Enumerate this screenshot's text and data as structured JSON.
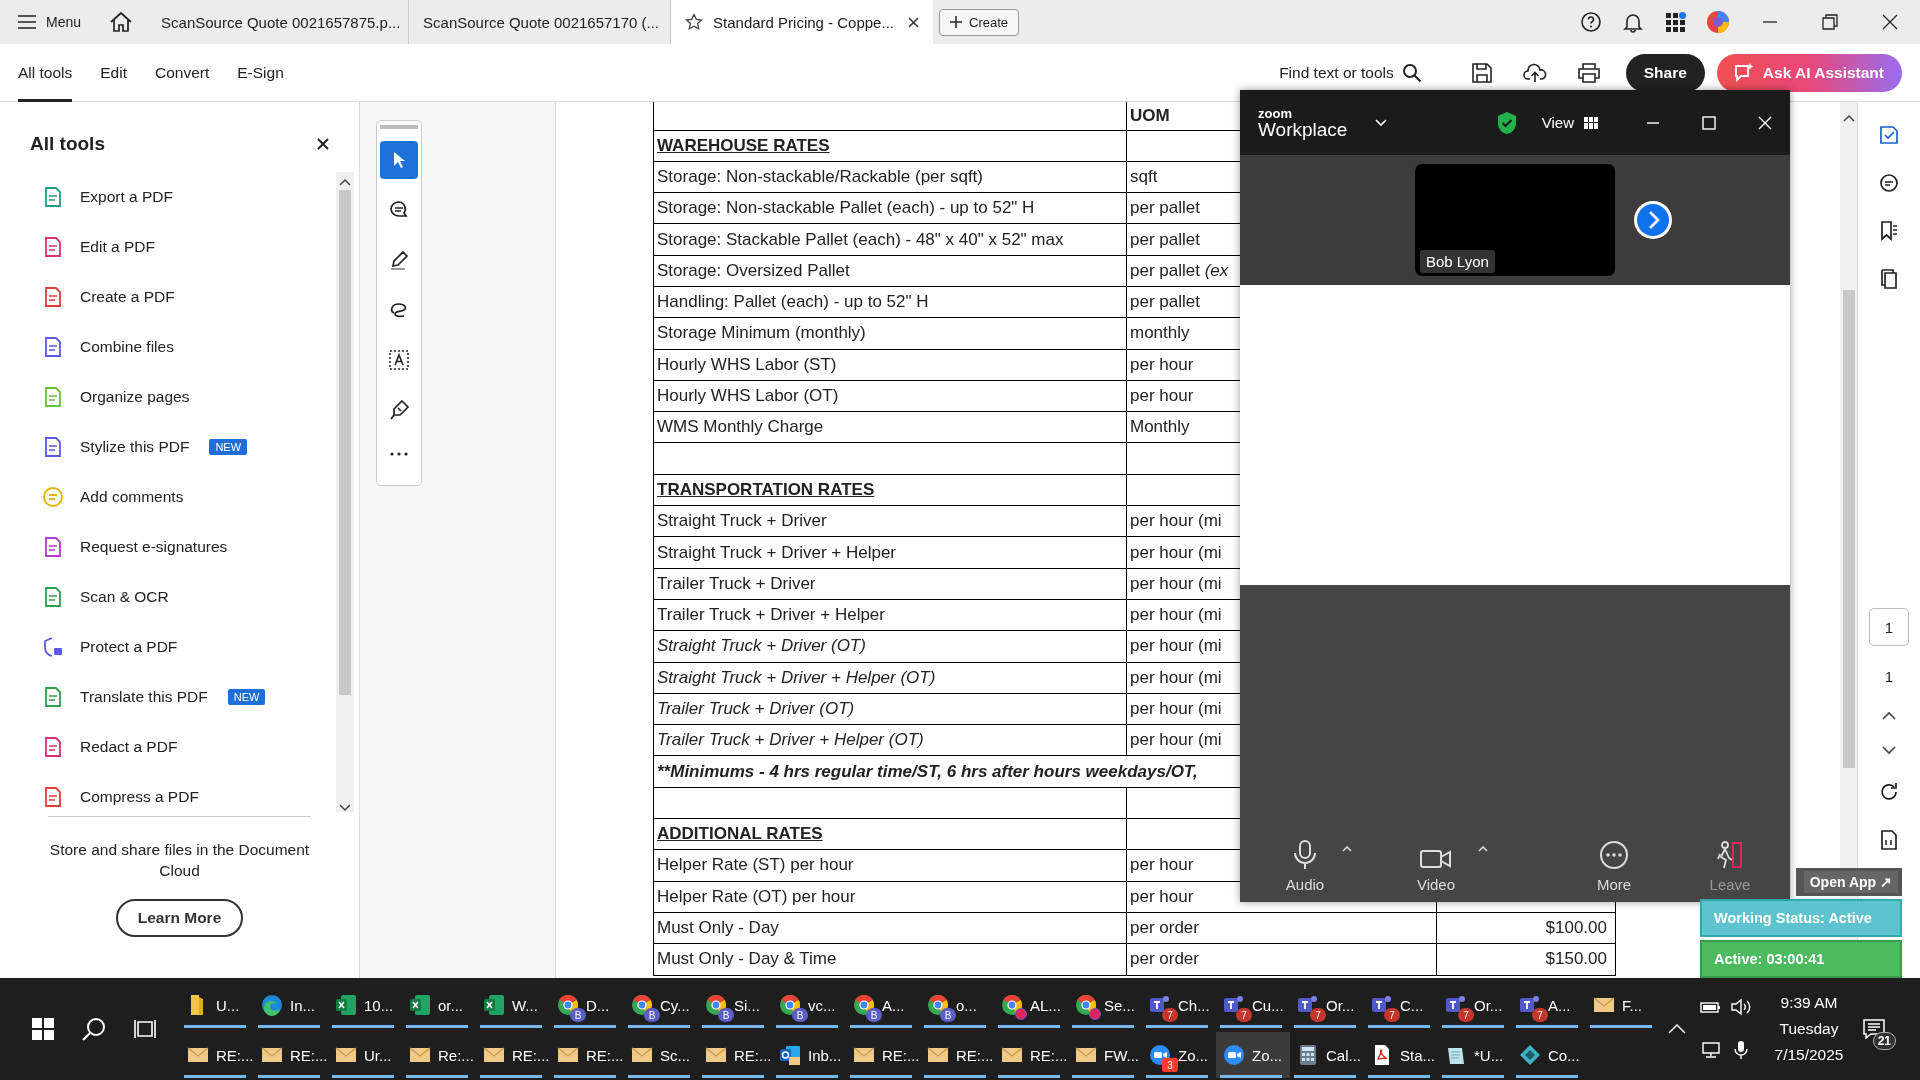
{
  "browser": {
    "menu_label": "Menu",
    "tabs": [
      {
        "title": "ScanSource Quote 0021657875.p...",
        "selected": false
      },
      {
        "title": "ScanSource Quote 0021657170 (...",
        "selected": false
      },
      {
        "title": "Standard Pricing - Coppe...",
        "selected": true
      }
    ],
    "create_label": "Create"
  },
  "toolbar": {
    "tabs": [
      {
        "label": "All tools",
        "selected": true
      },
      {
        "label": "Edit",
        "selected": false
      },
      {
        "label": "Convert",
        "selected": false
      },
      {
        "label": "E-Sign",
        "selected": false
      }
    ],
    "search_label": "Find text or tools",
    "share_label": "Share",
    "ai_label": "Ask AI Assistant"
  },
  "tools_panel": {
    "title": "All tools",
    "items": [
      {
        "label": "Export a PDF"
      },
      {
        "label": "Edit a PDF"
      },
      {
        "label": "Create a PDF"
      },
      {
        "label": "Combine files"
      },
      {
        "label": "Organize pages"
      },
      {
        "label": "Stylize this PDF",
        "badge": "NEW"
      },
      {
        "label": "Add comments"
      },
      {
        "label": "Request e-signatures"
      },
      {
        "label": "Scan & OCR"
      },
      {
        "label": "Protect a PDF"
      },
      {
        "label": "Translate this PDF",
        "badge": "NEW"
      },
      {
        "label": "Redact a PDF"
      },
      {
        "label": "Compress a PDF"
      }
    ],
    "cloud_text": "Store and share files in the Document Cloud",
    "learn_more": "Learn More"
  },
  "tool_rail": {
    "tools": [
      {
        "selected": true
      },
      {
        "selected": false
      },
      {
        "selected": false
      },
      {
        "selected": false
      },
      {
        "selected": false
      },
      {
        "selected": false
      }
    ]
  },
  "document": {
    "uom_header": "UOM",
    "rows": [
      {
        "kind": "section",
        "cells": [
          "WAREHOUSE RATES"
        ]
      },
      {
        "kind": "item",
        "cells": [
          "Storage: Non-stackable/Rackable (per sqft)",
          "sqft"
        ]
      },
      {
        "kind": "item",
        "cells": [
          "Storage: Non-stackable Pallet (each) - up to 52\" H",
          "per pallet"
        ]
      },
      {
        "kind": "item",
        "cells": [
          "Storage: Stackable Pallet  (each) - 48\" x 40\" x 52\" max",
          "per pallet"
        ]
      },
      {
        "kind": "item",
        "cells": [
          "Storage: Oversized Pallet",
          "per pallet *(ex*"
        ]
      },
      {
        "kind": "item",
        "cells": [
          "Handling: Pallet (each) - up to 52\" H",
          "per pallet"
        ]
      },
      {
        "kind": "item",
        "cells": [
          "Storage Minimum (monthly)",
          "monthly"
        ]
      },
      {
        "kind": "item",
        "cells": [
          "Hourly WHS Labor (ST)",
          "per hour"
        ]
      },
      {
        "kind": "item",
        "cells": [
          "Hourly WHS Labor (OT)",
          "per hour"
        ]
      },
      {
        "kind": "item",
        "cells": [
          "WMS Monthly Charge",
          "Monthly"
        ]
      },
      {
        "kind": "blank"
      },
      {
        "kind": "section",
        "cells": [
          "TRANSPORTATION RATES"
        ]
      },
      {
        "kind": "item",
        "cells": [
          "Straight Truck + Driver",
          "per hour (mi"
        ]
      },
      {
        "kind": "item",
        "cells": [
          "Straight Truck + Driver + Helper",
          "per hour (mi"
        ]
      },
      {
        "kind": "item",
        "cells": [
          "Trailer Truck + Driver",
          "per hour (mi"
        ]
      },
      {
        "kind": "item",
        "cells": [
          "Trailer Truck + Driver + Helper",
          "per hour (mi"
        ]
      },
      {
        "kind": "italic",
        "cells": [
          "Straight Truck + Driver (OT)",
          "per hour (mi"
        ]
      },
      {
        "kind": "italic",
        "cells": [
          "Straight Truck + Driver + Helper (OT)",
          "per hour (mi"
        ]
      },
      {
        "kind": "italic",
        "cells": [
          "Trailer Truck + Driver (OT)",
          "per hour (mi"
        ]
      },
      {
        "kind": "italic",
        "cells": [
          "Trailer Truck + Driver + Helper (OT)",
          "per hour (mi"
        ]
      },
      {
        "kind": "note",
        "cells": [
          "**Minimums -  4 hrs regular time/ST, 6 hrs after hours weekdays/OT,"
        ]
      },
      {
        "kind": "blank"
      },
      {
        "kind": "section",
        "cells": [
          "ADDITIONAL RATES"
        ]
      },
      {
        "kind": "item",
        "cells": [
          "Helper Rate (ST) per hour",
          "per hour"
        ]
      },
      {
        "kind": "item",
        "cells": [
          "Helper Rate (OT) per hour",
          "per hour"
        ]
      },
      {
        "kind": "item",
        "cells": [
          "Must Only - Day",
          "per order",
          "$100.00"
        ]
      },
      {
        "kind": "item",
        "cells": [
          "Must Only - Day & Time",
          "per order",
          "$150.00"
        ]
      }
    ]
  },
  "zoom_window": {
    "brand": "zoom",
    "app": "Workplace",
    "view_label": "View",
    "participant": "Bob Lyon",
    "controls": [
      {
        "kind": "audio",
        "label": "Audio"
      },
      {
        "kind": "video",
        "label": "Video"
      },
      {
        "kind": "more",
        "label": "More"
      },
      {
        "kind": "leave",
        "label": "Leave"
      }
    ]
  },
  "status_widget": {
    "open_app": "Open App ↗",
    "working_status": "Working Status: Active",
    "active_timer": "Active: 03:00:41"
  },
  "right_rail": {
    "page_input": "1",
    "page_total": "1"
  },
  "taskbar": {
    "rows": [
      [
        {
          "kind": "folder",
          "label": "U...",
          "selected": false
        },
        {
          "kind": "edge",
          "label": "In...",
          "selected": false
        },
        {
          "kind": "excel",
          "label": "10...",
          "selected": false
        },
        {
          "kind": "excel",
          "label": "or...",
          "selected": false
        },
        {
          "kind": "excel",
          "label": "W...",
          "selected": false
        },
        {
          "kind": "chrome",
          "label": "D...",
          "badge": "B",
          "selected": false
        },
        {
          "kind": "chrome",
          "label": "Cy...",
          "badge": "B",
          "selected": false
        },
        {
          "kind": "chrome",
          "label": "Si...",
          "badge": "B",
          "selected": false
        },
        {
          "kind": "chrome",
          "label": "vc...",
          "badge": "B",
          "selected": false
        },
        {
          "kind": "chrome",
          "label": "A...",
          "badge": "B",
          "selected": false
        },
        {
          "kind": "chrome",
          "label": "o...",
          "badge": "B",
          "selected": false
        },
        {
          "kind": "chrome_alert",
          "label": "AL...",
          "selected": false
        },
        {
          "kind": "chrome_alert",
          "label": "Se...",
          "selected": false
        },
        {
          "kind": "teams",
          "label": "Ch...",
          "badge": "7",
          "selected": false
        },
        {
          "kind": "teams",
          "label": "Cu...",
          "badge": "7",
          "selected": false
        },
        {
          "kind": "teams",
          "label": "Or...",
          "badge": "7",
          "selected": false
        },
        {
          "kind": "teams",
          "label": "C...",
          "badge": "7",
          "selected": false
        },
        {
          "kind": "teams",
          "label": "Or...",
          "badge": "7",
          "selected": false
        },
        {
          "kind": "teams",
          "label": "A...",
          "badge": "7",
          "selected": false
        },
        {
          "kind": "mail",
          "label": "F...",
          "selected": false
        }
      ],
      [
        {
          "kind": "mail",
          "label": "RE:...",
          "selected": false
        },
        {
          "kind": "mail",
          "label": "RE:...",
          "selected": false
        },
        {
          "kind": "mail",
          "label": "Ur...",
          "selected": false
        },
        {
          "kind": "mail",
          "label": "Re:...",
          "selected": false
        },
        {
          "kind": "mail",
          "label": "RE:...",
          "selected": false
        },
        {
          "kind": "mail",
          "label": "RE:...",
          "selected": false
        },
        {
          "kind": "mail",
          "label": "Sc...",
          "selected": false
        },
        {
          "kind": "mail",
          "label": "RE:...",
          "selected": false
        },
        {
          "kind": "outlook",
          "label": "Inb...",
          "selected": false
        },
        {
          "kind": "mail",
          "label": "RE:...",
          "selected": false
        },
        {
          "kind": "mail",
          "label": "RE:...",
          "selected": false
        },
        {
          "kind": "mail",
          "label": "RE:...",
          "selected": false
        },
        {
          "kind": "mail",
          "label": "FW...",
          "selected": false
        },
        {
          "kind": "zoom",
          "label": "Zo...",
          "badge": "3",
          "selected": false
        },
        {
          "kind": "zoom",
          "label": "Zo...",
          "selected": true
        },
        {
          "kind": "calculator",
          "label": "Cal...",
          "selected": false
        },
        {
          "kind": "pdf",
          "label": "Sta...",
          "selected": false
        },
        {
          "kind": "notepad",
          "label": "*U...",
          "selected": false
        },
        {
          "kind": "generic",
          "label": "Co...",
          "selected": false
        }
      ]
    ],
    "clock": {
      "time": "9:39 AM",
      "day": "Tuesday",
      "date": "7/15/2025"
    },
    "notifications": "21"
  }
}
